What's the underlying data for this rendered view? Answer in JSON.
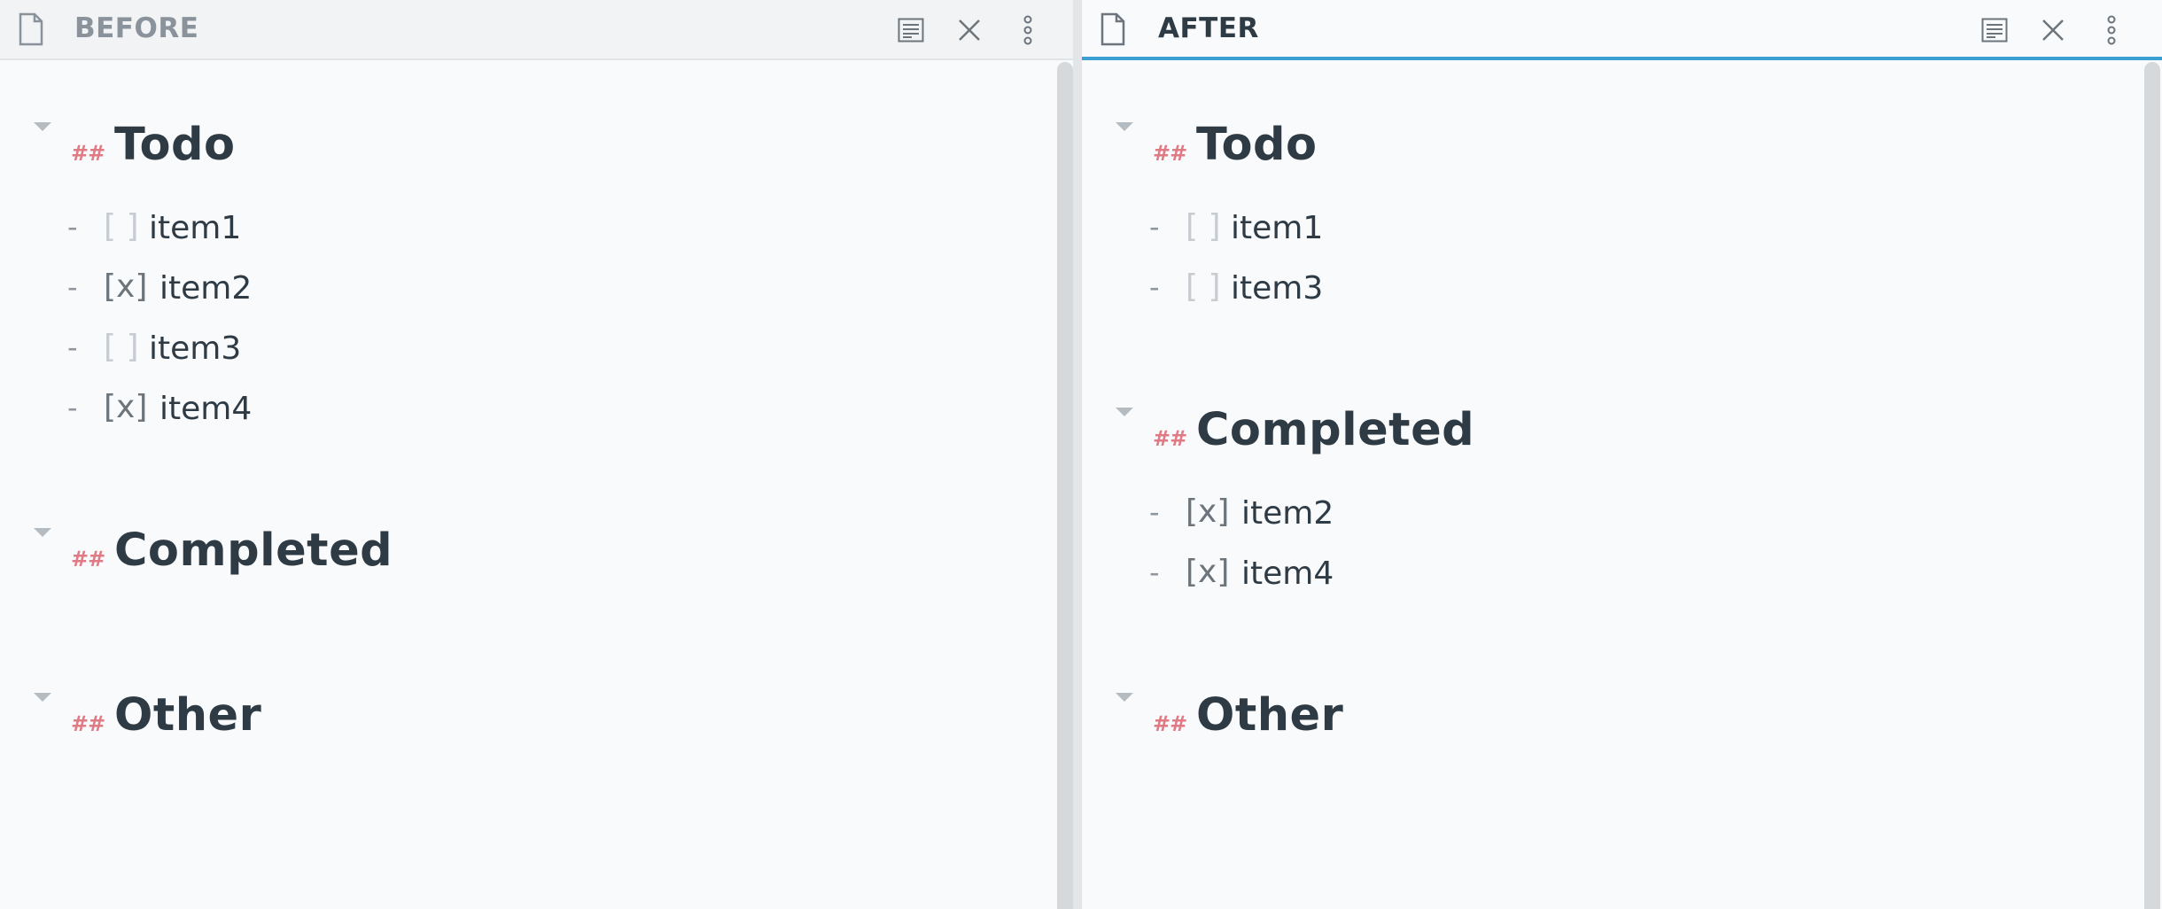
{
  "panes": {
    "before": {
      "title": "BEFORE",
      "sections": [
        {
          "hashes": "##",
          "title": "Todo",
          "items": [
            {
              "marker": "-",
              "checkbox": "[ ]",
              "checked": false,
              "text": "item1"
            },
            {
              "marker": "-",
              "checkbox": "[x]",
              "checked": true,
              "text": "item2"
            },
            {
              "marker": "-",
              "checkbox": "[ ]",
              "checked": false,
              "text": "item3"
            },
            {
              "marker": "-",
              "checkbox": "[x]",
              "checked": true,
              "text": "item4"
            }
          ]
        },
        {
          "hashes": "##",
          "title": "Completed",
          "items": []
        },
        {
          "hashes": "##",
          "title": "Other",
          "items": []
        }
      ]
    },
    "after": {
      "title": "AFTER",
      "sections": [
        {
          "hashes": "##",
          "title": "Todo",
          "items": [
            {
              "marker": "-",
              "checkbox": "[ ]",
              "checked": false,
              "text": "item1"
            },
            {
              "marker": "-",
              "checkbox": "[ ]",
              "checked": false,
              "text": "item3"
            }
          ]
        },
        {
          "hashes": "##",
          "title": "Completed",
          "items": [
            {
              "marker": "-",
              "checkbox": "[x]",
              "checked": true,
              "text": "item2"
            },
            {
              "marker": "-",
              "checkbox": "[x]",
              "checked": true,
              "text": "item4"
            }
          ]
        },
        {
          "hashes": "##",
          "title": "Other",
          "items": []
        }
      ]
    }
  },
  "icons": {
    "file": "file-icon",
    "reading_view": "reading-view-icon",
    "close": "close-icon",
    "more": "more-options-icon",
    "fold": "fold-arrow-icon"
  },
  "colors": {
    "active_tab_accent": "#3aa0d4",
    "heading_hashes": "#e07a84",
    "text": "#2e3a44"
  }
}
